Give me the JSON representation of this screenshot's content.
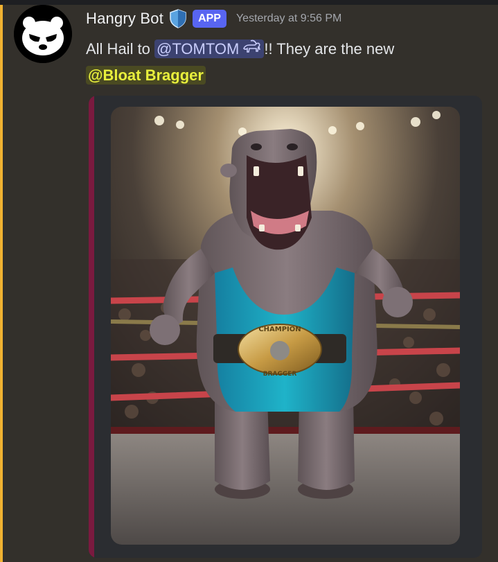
{
  "message": {
    "author": "Hangry Bot",
    "verified_badge_icon": "shield-icon",
    "app_tag": "APP",
    "timestamp": "Yesterday at 9:56 PM",
    "text_before_mention": "All Hail to ",
    "user_mention": "@TOMTOM",
    "user_mention_icon": "goat-icon",
    "text_after_mention": "!! They are the new",
    "role_mention": "@Bloat Bragger"
  },
  "embed": {
    "image_icon": "hippo-wrestler-image",
    "belt_text_top": "CHAMPION",
    "belt_text_bottom": "BRAGGER"
  },
  "colors": {
    "accent_app": "#5865f2",
    "mention_highlight_bar": "#f0b232",
    "embed_bar": "#7a1a3f",
    "role_mention_color": "#e8ef3c"
  }
}
